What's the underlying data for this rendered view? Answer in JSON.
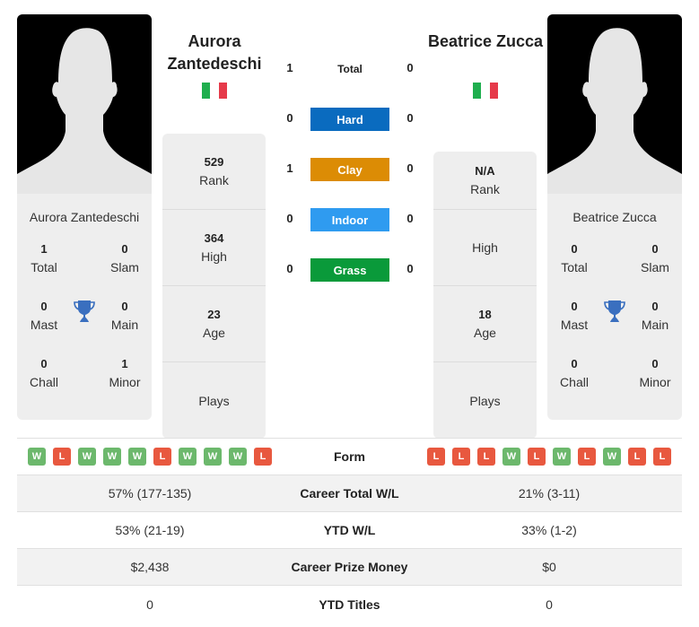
{
  "colors": {
    "hard": "#0a6bbf",
    "clay": "#dc8c05",
    "indoor": "#2f9bf0",
    "grass": "#0a9a3a",
    "win": "#6cb86c",
    "loss": "#e8583f",
    "trophy": "#3a6fbf",
    "flag_green": "#1fae4e",
    "flag_red": "#e63a4a"
  },
  "player1": {
    "name": "Aurora Zantedeschi",
    "card_name": "Aurora Zantedeschi",
    "flag": "italy-flag",
    "rank": "529",
    "rank_label": "Rank",
    "high": "364",
    "high_label": "High",
    "age": "23",
    "age_label": "Age",
    "plays": "",
    "plays_label": "Plays",
    "titles": {
      "total": "1",
      "total_label": "Total",
      "slam": "0",
      "slam_label": "Slam",
      "mast": "0",
      "mast_label": "Mast",
      "main": "0",
      "main_label": "Main",
      "chall": "0",
      "chall_label": "Chall",
      "minor": "1",
      "minor_label": "Minor"
    }
  },
  "player2": {
    "name": "Beatrice Zucca",
    "card_name": "Beatrice Zucca",
    "flag": "italy-flag",
    "rank": "N/A",
    "rank_label": "Rank",
    "high": "",
    "high_label": "High",
    "age": "18",
    "age_label": "Age",
    "plays": "",
    "plays_label": "Plays",
    "titles": {
      "total": "0",
      "total_label": "Total",
      "slam": "0",
      "slam_label": "Slam",
      "mast": "0",
      "mast_label": "Mast",
      "main": "0",
      "main_label": "Main",
      "chall": "0",
      "chall_label": "Chall",
      "minor": "0",
      "minor_label": "Minor"
    }
  },
  "h2h": {
    "total": {
      "label": "Total",
      "p1": "1",
      "p2": "0"
    },
    "hard": {
      "label": "Hard",
      "p1": "0",
      "p2": "0"
    },
    "clay": {
      "label": "Clay",
      "p1": "1",
      "p2": "0"
    },
    "indoor": {
      "label": "Indoor",
      "p1": "0",
      "p2": "0"
    },
    "grass": {
      "label": "Grass",
      "p1": "0",
      "p2": "0"
    }
  },
  "comparison": {
    "form": {
      "label": "Form",
      "p1": [
        "W",
        "L",
        "W",
        "W",
        "W",
        "L",
        "W",
        "W",
        "W",
        "L"
      ],
      "p2": [
        "L",
        "L",
        "L",
        "W",
        "L",
        "W",
        "L",
        "W",
        "L",
        "L"
      ]
    },
    "rows": [
      {
        "label": "Career Total W/L",
        "p1": "57% (177-135)",
        "p2": "21% (3-11)"
      },
      {
        "label": "YTD W/L",
        "p1": "53% (21-19)",
        "p2": "33% (1-2)"
      },
      {
        "label": "Career Prize Money",
        "p1": "$2,438",
        "p2": "$0"
      },
      {
        "label": "YTD Titles",
        "p1": "0",
        "p2": "0"
      }
    ]
  }
}
